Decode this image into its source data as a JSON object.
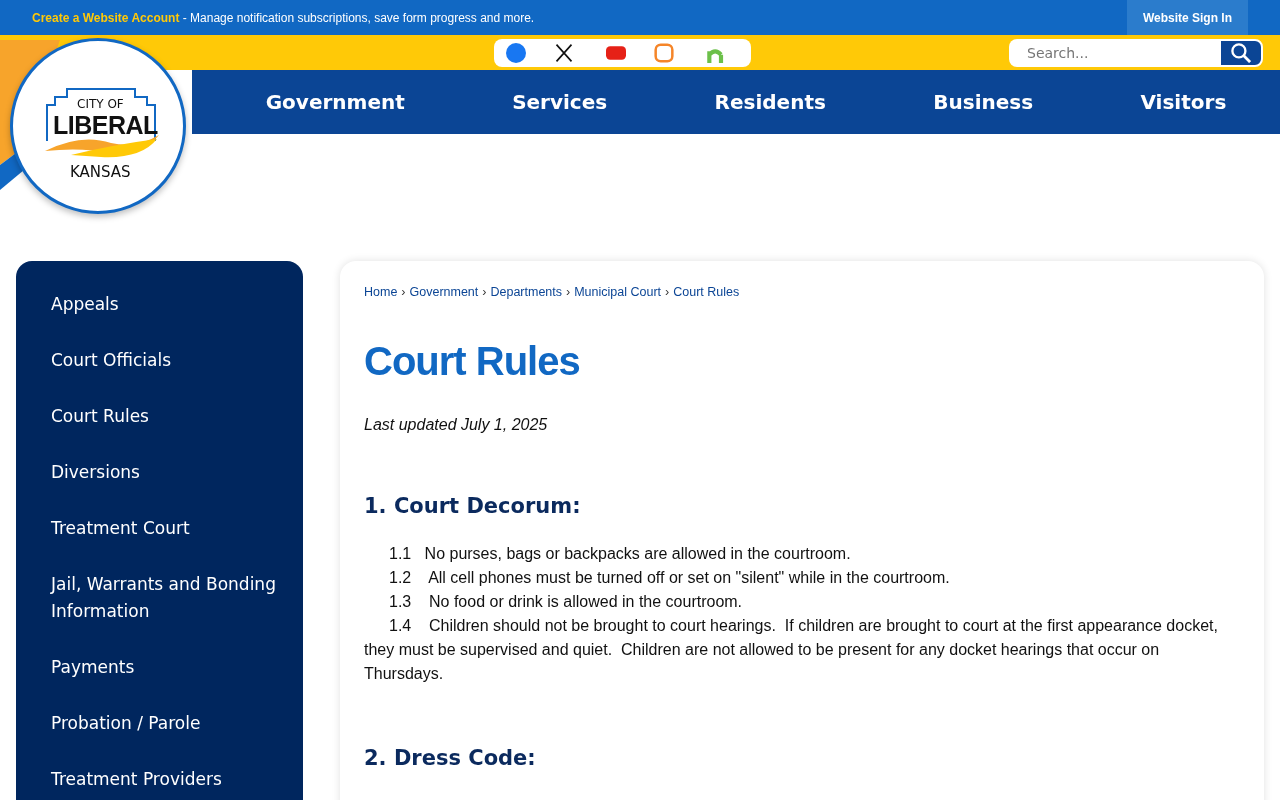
{
  "top_bar": {
    "link": "Create a Website Account",
    "message": " - Manage notification subscriptions, save form progress and more.",
    "sign_in": "Website Sign In"
  },
  "logo": {
    "line_1": "CITY OF",
    "line_2": "LIBERAL",
    "line_3": "KANSAS"
  },
  "search": {
    "placeholder": "Search..."
  },
  "nav": [
    "Government",
    "Services",
    "Residents",
    "Business",
    "Visitors"
  ],
  "sidebar": {
    "items": [
      "Appeals",
      "Court Officials",
      "Court Rules",
      "Diversions",
      "Treatment Court",
      "Jail, Warrants and Bonding Information",
      "Payments",
      "Probation / Parole",
      "Treatment Providers"
    ]
  },
  "breadcrumb": [
    "Home",
    "Government",
    "Departments",
    "Municipal Court",
    "Court Rules"
  ],
  "breadcrumb_separator": "›",
  "title": "Court Rules",
  "updated": "Last updated July 1, 2025",
  "sections": [
    {
      "heading": "1.  Court Decorum:",
      "items": [
        "1.1   No purses, bags or backpacks are allowed in the courtroom.",
        "1.2    All cell phones must be turned off or set on \"silent\" while in the courtroom.",
        "1.3    No food or drink is allowed in the courtroom.",
        "1.4    Children should not be brought to court hearings.  If children are brought to court at the first appearance docket, they must be supervised and quiet.  Children are not allowed to be present for any docket hearings that occur on Thursdays."
      ]
    },
    {
      "heading": "2.  Dress Code:"
    }
  ]
}
